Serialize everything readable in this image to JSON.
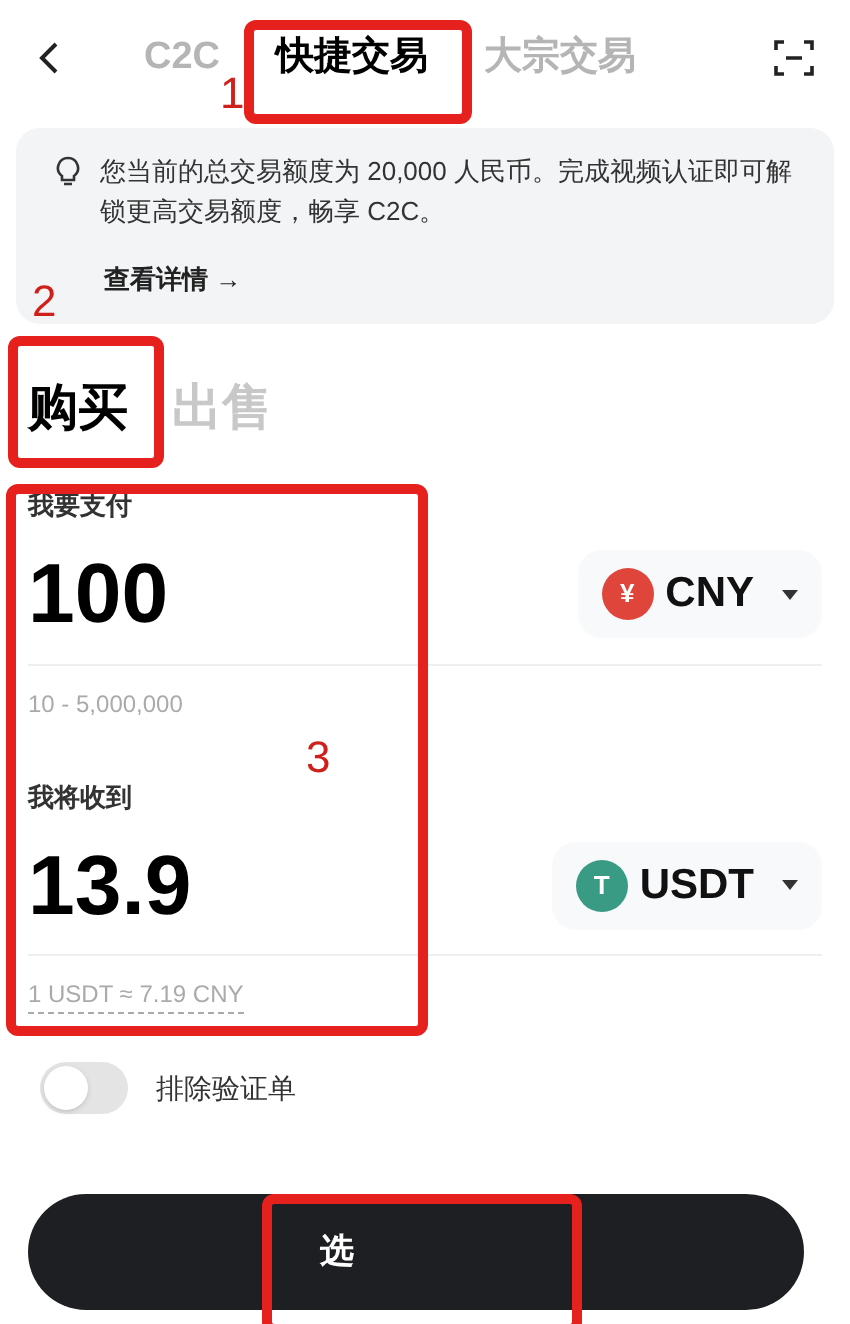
{
  "header": {
    "tabs": [
      {
        "label": "C2C",
        "selected": false
      },
      {
        "label": "快捷交易",
        "selected": true
      },
      {
        "label": "大宗交易",
        "selected": false
      }
    ]
  },
  "notice": {
    "text": "您当前的总交易额度为 20,000 人民币。完成视频认证即可解锁更高交易额度，畅享 C2C。",
    "link": "查看详情 →"
  },
  "trade_tabs": [
    {
      "label": "购买",
      "selected": true
    },
    {
      "label": "出售",
      "selected": false
    }
  ],
  "pay": {
    "label": "我要支付",
    "amount": "100",
    "currency": "CNY",
    "currency_symbol": "¥",
    "hint": "10 - 5,000,000"
  },
  "receive": {
    "label": "我将收到",
    "amount": "13.9",
    "currency": "USDT",
    "currency_symbol": "T",
    "hint": "1 USDT ≈ 7.19 CNY"
  },
  "exclude_toggle": {
    "label": "排除验证单",
    "on": false
  },
  "submit": {
    "label": "选"
  },
  "annotations": [
    {
      "number": "1"
    },
    {
      "number": "2"
    },
    {
      "number": "3"
    }
  ]
}
